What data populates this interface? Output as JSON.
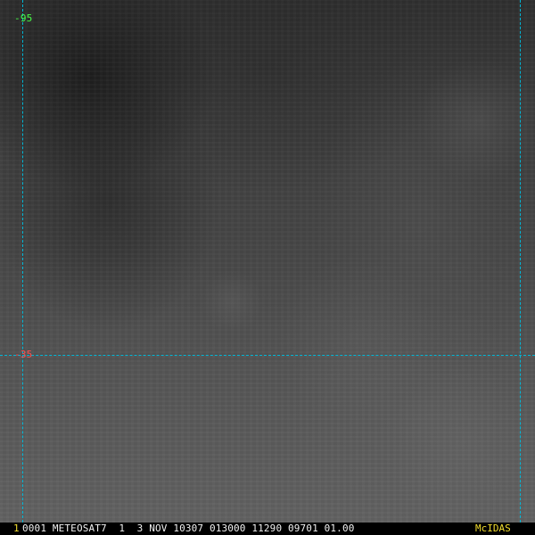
{
  "overlay": {
    "latitude_labels": [
      {
        "text": "-95",
        "color": "#48ff48"
      },
      {
        "text": "-35",
        "color": "#ff5050"
      }
    ]
  },
  "status_bar": {
    "frame": "1",
    "info": "0001 METEOSAT7  1  3 NOV 10307 013000 11290 09701 01.00",
    "brand": "McIDAS"
  }
}
